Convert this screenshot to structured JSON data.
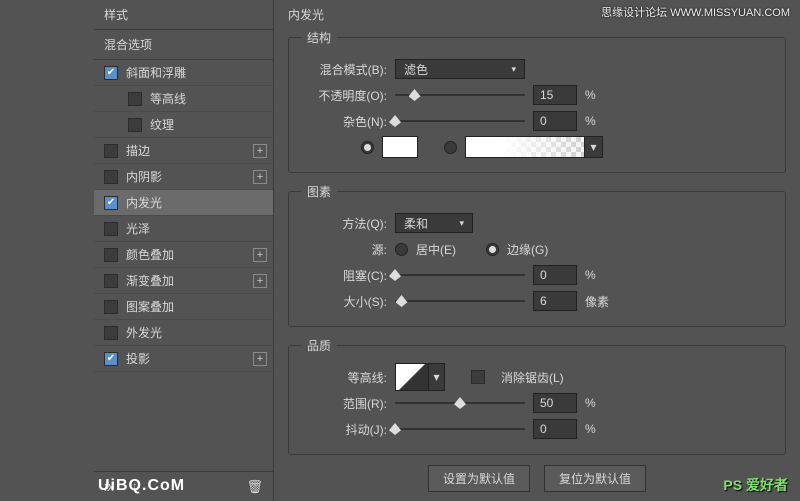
{
  "sidebar": {
    "style_header": "样式",
    "blend_header": "混合选项",
    "items": [
      {
        "label": "斜面和浮雕",
        "checked": true,
        "plus": false,
        "indent": false
      },
      {
        "label": "等高线",
        "checked": false,
        "plus": false,
        "indent": true
      },
      {
        "label": "纹理",
        "checked": false,
        "plus": false,
        "indent": true
      },
      {
        "label": "描边",
        "checked": false,
        "plus": true,
        "indent": false
      },
      {
        "label": "内阴影",
        "checked": false,
        "plus": true,
        "indent": false
      },
      {
        "label": "内发光",
        "checked": true,
        "plus": false,
        "indent": false,
        "selected": true
      },
      {
        "label": "光泽",
        "checked": false,
        "plus": false,
        "indent": false
      },
      {
        "label": "颜色叠加",
        "checked": false,
        "plus": true,
        "indent": false
      },
      {
        "label": "渐变叠加",
        "checked": false,
        "plus": true,
        "indent": false
      },
      {
        "label": "图案叠加",
        "checked": false,
        "plus": false,
        "indent": false
      },
      {
        "label": "外发光",
        "checked": false,
        "plus": false,
        "indent": false
      },
      {
        "label": "投影",
        "checked": true,
        "plus": true,
        "indent": false
      }
    ],
    "fx": "fx"
  },
  "panel": {
    "title": "内发光",
    "structure": {
      "legend": "结构",
      "blend_label": "混合模式(B):",
      "blend_value": "滤色",
      "opacity_label": "不透明度(O):",
      "opacity_value": "15",
      "opacity_unit": "%",
      "noise_label": "杂色(N):",
      "noise_value": "0",
      "noise_unit": "%"
    },
    "element": {
      "legend": "图素",
      "method_label": "方法(Q):",
      "method_value": "柔和",
      "source_label": "源:",
      "center_label": "居中(E)",
      "edge_label": "边缘(G)",
      "choke_label": "阻塞(C):",
      "choke_value": "0",
      "choke_unit": "%",
      "size_label": "大小(S):",
      "size_value": "6",
      "size_unit": "像素"
    },
    "quality": {
      "legend": "品质",
      "contour_label": "等高线:",
      "aa_label": "消除锯齿(L)",
      "range_label": "范围(R):",
      "range_value": "50",
      "range_unit": "%",
      "jitter_label": "抖动(J):",
      "jitter_value": "0",
      "jitter_unit": "%"
    },
    "buttons": {
      "default": "设置为默认值",
      "reset": "复位为默认值"
    }
  },
  "watermarks": {
    "top": "思缘设计论坛  WWW.MISSYUAN.COM",
    "bl": "UiBQ.CoM",
    "br": "PS 爱好者"
  }
}
